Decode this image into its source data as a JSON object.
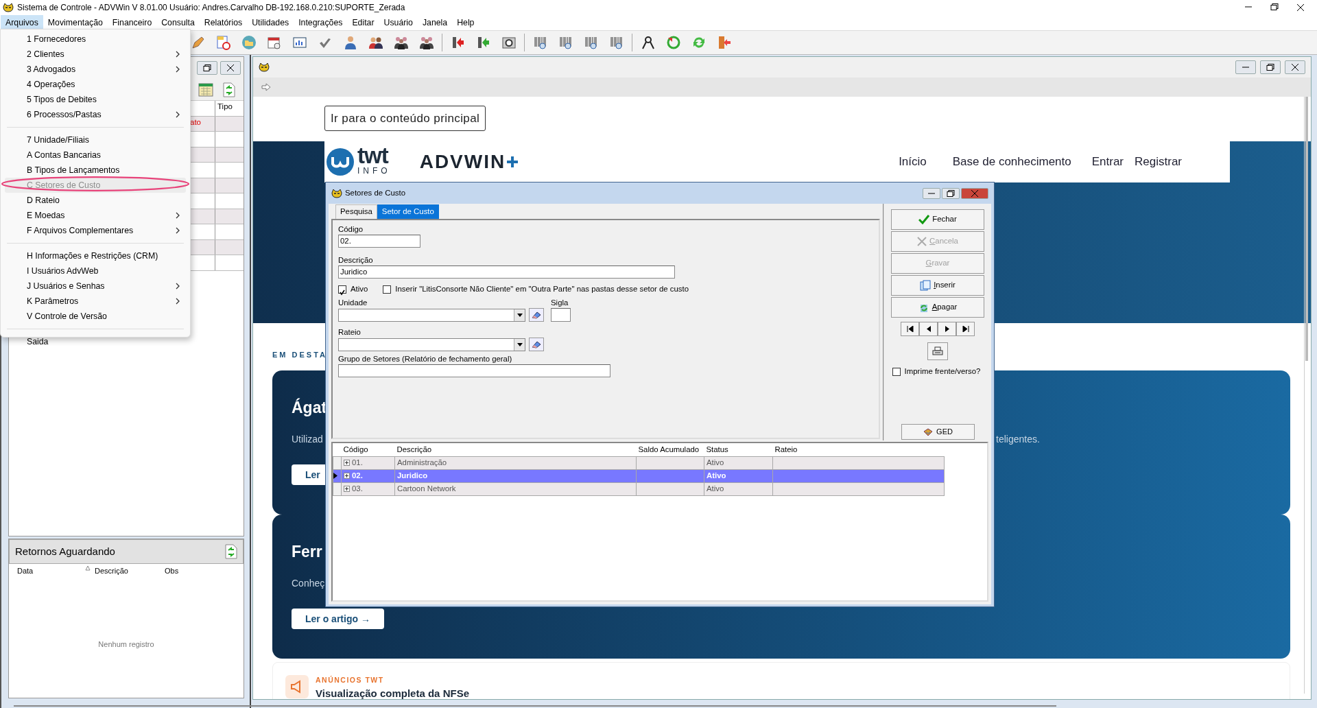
{
  "window": {
    "title": "Sistema de Controle - ADVWin  V 8.01.00  Usuário: Andres.Carvalho  DB-192.168.0.210:SUPORTE_Zerada"
  },
  "menubar": [
    {
      "label": "Arquivos",
      "selected": true
    },
    {
      "label": "Movimentação",
      "selected": false
    },
    {
      "label": "Financeiro",
      "selected": false
    },
    {
      "label": "Consulta",
      "selected": false
    },
    {
      "label": "Relatórios",
      "selected": false
    },
    {
      "label": "Utilidades",
      "selected": false
    },
    {
      "label": "Integrações",
      "selected": false
    },
    {
      "label": "Editar",
      "selected": false
    },
    {
      "label": "Usuário",
      "selected": false
    },
    {
      "label": "Janela",
      "selected": false
    },
    {
      "label": "Help",
      "selected": false
    }
  ],
  "open_menu": {
    "groups": [
      [
        {
          "label": "1 Fornecedores",
          "submenu": false,
          "disabled": false,
          "highlighted": false
        },
        {
          "label": "2 Clientes",
          "submenu": true,
          "disabled": false,
          "highlighted": false
        },
        {
          "label": "3 Advogados",
          "submenu": true,
          "disabled": false,
          "highlighted": false
        },
        {
          "label": "4 Operações",
          "submenu": false,
          "disabled": false,
          "highlighted": false
        },
        {
          "label": "5 Tipos de Debites",
          "submenu": false,
          "disabled": false,
          "highlighted": false
        },
        {
          "label": "6 Processos/Pastas",
          "submenu": true,
          "disabled": false,
          "highlighted": false
        }
      ],
      [
        {
          "label": "7 Unidade/Filiais",
          "submenu": false,
          "disabled": false,
          "highlighted": false
        },
        {
          "label": "A Contas Bancarias",
          "submenu": false,
          "disabled": false,
          "highlighted": false
        },
        {
          "label": "B Tipos de Lançamentos",
          "submenu": false,
          "disabled": false,
          "highlighted": false
        },
        {
          "label": "C Setores de Custo",
          "submenu": false,
          "disabled": true,
          "highlighted": true
        },
        {
          "label": "D Rateio",
          "submenu": false,
          "disabled": false,
          "highlighted": false
        },
        {
          "label": "E Moedas",
          "submenu": true,
          "disabled": false,
          "highlighted": false
        },
        {
          "label": "F Arquivos Complementares",
          "submenu": true,
          "disabled": false,
          "highlighted": false
        }
      ],
      [
        {
          "label": "H Informações e Restrições (CRM)",
          "submenu": false,
          "disabled": false,
          "highlighted": false
        },
        {
          "label": "I Usuários AdvWeb",
          "submenu": false,
          "disabled": false,
          "highlighted": false
        },
        {
          "label": "J Usuários e Senhas",
          "submenu": true,
          "disabled": false,
          "highlighted": false
        },
        {
          "label": "K Parâmetros",
          "submenu": true,
          "disabled": false,
          "highlighted": false
        },
        {
          "label": "V Controle de Versão",
          "submenu": false,
          "disabled": false,
          "highlighted": false
        }
      ],
      [
        {
          "label": "Saida",
          "submenu": false,
          "disabled": false,
          "highlighted": false
        }
      ]
    ],
    "annotation": {
      "kind": "ellipse"
    }
  },
  "left_panel": {
    "grid": {
      "column": "Tipo",
      "first_cell": "ato"
    },
    "returns": {
      "title": "Retornos Aguardando",
      "columns": [
        {
          "label": "Data",
          "sorted": true
        },
        {
          "label": "Descrição",
          "sorted": false
        },
        {
          "label": "Obs",
          "sorted": false
        }
      ],
      "empty_text": "Nenhum registro"
    }
  },
  "browser": {
    "skip_link": "Ir para o conteúdo principal",
    "logo": {
      "word": "twt",
      "sub": "INFO",
      "product": "ADVWIN"
    },
    "nav": [
      "Início",
      "Base de conhecimento",
      "Entrar",
      "Registrar"
    ],
    "section_label": "EM DESTA",
    "cards": [
      {
        "title": "Ágat",
        "text": "Utilizad",
        "text_tail": "teligentes.",
        "button": "Ler"
      },
      {
        "title": "Ferr",
        "text": "Conheç",
        "button": "Ler o artigo →"
      }
    ],
    "announcement": {
      "tag": "ANÚNCIOS TWT",
      "title": "Visualização completa da NFSe"
    }
  },
  "dialog": {
    "title": "Setores de Custo",
    "tabs": [
      {
        "label": "Pesquisa",
        "selected": false
      },
      {
        "label": "Setor de Custo",
        "selected": true
      }
    ],
    "codigo": {
      "label": "Código",
      "value": "02."
    },
    "descricao": {
      "label": "Descrição",
      "value": "Juridico"
    },
    "checkboxes": [
      {
        "label": "Ativo",
        "checked": true
      },
      {
        "label": "Inserir \"LitisConsorte Não Cliente\" em \"Outra Parte\" nas pastas desse setor de custo",
        "checked": false
      }
    ],
    "unidade_label": "Unidade",
    "sigla_label": "Sigla",
    "rateio_label": "Rateio",
    "grupo_label": "Grupo de Setores (Relatório de fechamento geral)",
    "buttons": [
      {
        "label": "Fechar",
        "kind": "check",
        "disabled": false,
        "mnemonic": false
      },
      {
        "label": "Cancela",
        "kind": "cancel",
        "disabled": true,
        "mnemonic": true
      },
      {
        "label": "Gravar",
        "kind": "none",
        "disabled": true,
        "mnemonic": true
      },
      {
        "label": "Inserir",
        "kind": "insert",
        "disabled": false,
        "mnemonic": true
      },
      {
        "label": "Apagar",
        "kind": "delete",
        "disabled": false,
        "mnemonic": true
      }
    ],
    "print_duplex": {
      "label": "Imprime frente/verso?",
      "checked": false
    },
    "ged_button": "GED",
    "grid": {
      "columns": [
        "Código",
        "Descrição",
        "Saldo Acumulado",
        "Status",
        "Rateio"
      ],
      "rows": [
        {
          "codigo": "01.",
          "descricao": "Administração",
          "status": "Ativo",
          "selected": false
        },
        {
          "codigo": "02.",
          "descricao": "Juridico",
          "status": "Ativo",
          "selected": true
        },
        {
          "codigo": "03.",
          "descricao": "Cartoon Network",
          "status": "Ativo",
          "selected": false
        }
      ]
    }
  }
}
